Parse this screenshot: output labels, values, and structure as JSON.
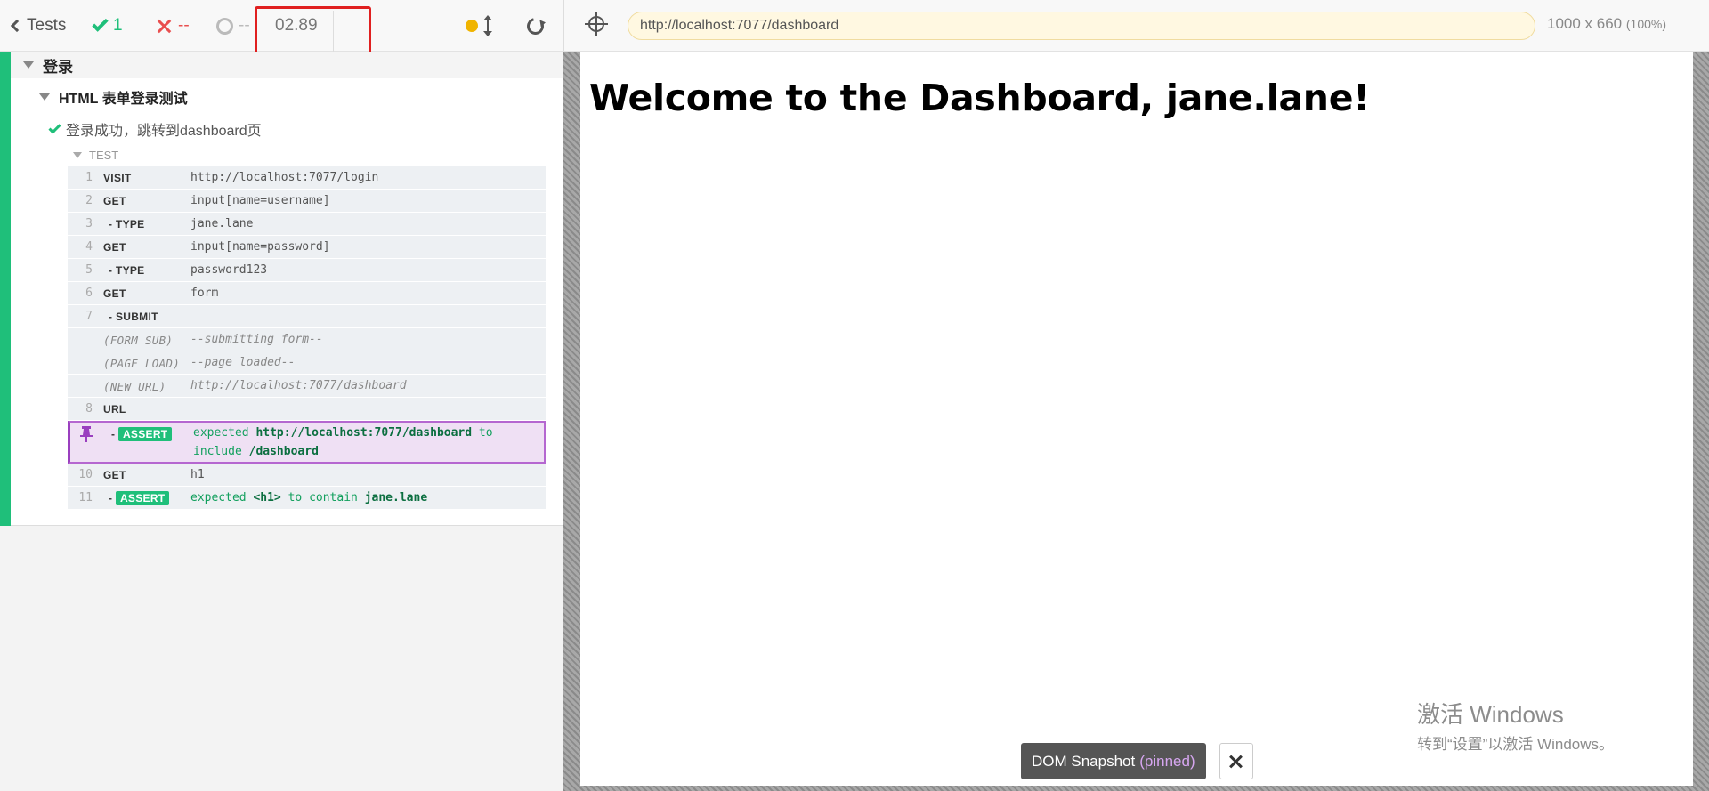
{
  "reporter": {
    "back_label": "Tests",
    "passed": "1",
    "failed": "--",
    "pending": "--",
    "duration": "02.89",
    "suite": "登录",
    "describe": "HTML 表单登录测试",
    "test": "登录成功，跳转到dashboard页",
    "section_label": "TEST",
    "commands": [
      {
        "num": "1",
        "name": "VISIT",
        "msg": "http://localhost:7077/login"
      },
      {
        "num": "2",
        "name": "GET",
        "msg": "input[name=username]"
      },
      {
        "num": "3",
        "name": "TYPE",
        "msg": "jane.lane"
      },
      {
        "num": "4",
        "name": "GET",
        "msg": "input[name=password]"
      },
      {
        "num": "5",
        "name": "TYPE",
        "msg": "password123"
      },
      {
        "num": "6",
        "name": "GET",
        "msg": "form"
      },
      {
        "num": "7",
        "name": "SUBMIT",
        "msg": ""
      },
      {
        "num": "",
        "name": "(FORM SUB)",
        "msg": "--submitting form--"
      },
      {
        "num": "",
        "name": "(PAGE LOAD)",
        "msg": "--page loaded--"
      },
      {
        "num": "",
        "name": "(NEW URL)",
        "msg": "http://localhost:7077/dashboard"
      },
      {
        "num": "8",
        "name": "URL",
        "msg": ""
      },
      {
        "num": "",
        "name": "ASSERT",
        "msg_parts": [
          "expected",
          "http://localhost:7077/dashboard",
          "to",
          "include",
          "/dashboard"
        ]
      },
      {
        "num": "10",
        "name": "GET",
        "msg": "h1"
      },
      {
        "num": "11",
        "name": "ASSERT",
        "msg_parts": [
          "expected",
          "<h1>",
          "to contain",
          "jane.lane"
        ]
      }
    ]
  },
  "aut": {
    "url": "http://localhost:7077/dashboard",
    "viewport": "1000 x 660",
    "scale": "(100%)",
    "heading": "Welcome to the Dashboard, jane.lane!"
  },
  "snapshot": {
    "label": "DOM Snapshot",
    "state": "(pinned)"
  },
  "windows": {
    "line1": "激活 Windows",
    "line2": "转到“设置”以激活 Windows。"
  },
  "colors": {
    "pass": "#1fbf7a",
    "fail": "#e94f4f",
    "pinned_border": "#b567d0",
    "url_bar_bg": "#fff8e1",
    "highlight_box": "#e02020"
  },
  "icons": [
    "chevron-left-icon",
    "check-icon",
    "x-icon",
    "spinner-icon",
    "status-dot-icon",
    "scroll-updown-icon",
    "reload-icon",
    "crosshair-icon",
    "pin-icon",
    "close-icon"
  ]
}
